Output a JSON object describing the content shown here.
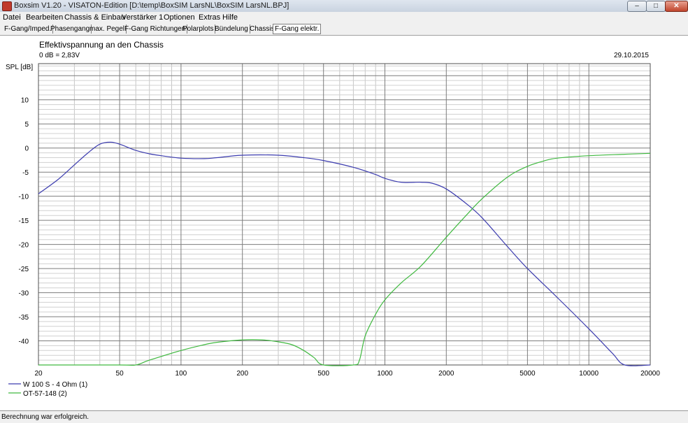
{
  "window": {
    "title": "Boxsim V1.20 - VISATON-Edition [D:\\temp\\BoxSIM LarsNL\\BoxSIM LarsNL.BPJ]",
    "min_glyph": "–",
    "max_glyph": "□",
    "close_glyph": "✕"
  },
  "menu": [
    "Datei",
    "Bearbeiten",
    "Chassis & Einbau",
    "Verstärker 1",
    "Optionen",
    "Extras",
    "Hilfe"
  ],
  "tabs": [
    "F-Gang/Imped.",
    "Phasengang",
    "max. Pegel",
    "F-Gang Richtungen",
    "Polarplots",
    "Bündelung",
    "Chassis",
    "F-Gang elektr."
  ],
  "active_tab": 7,
  "chart_data": {
    "type": "line",
    "title": "Effektivspannung an den Chassis",
    "subtitle": "0 dB = 2,83V",
    "date": "29.10.2015",
    "ylabel": "SPL [dB]",
    "xlabel": "",
    "xscale": "log",
    "xlim": [
      20,
      20000
    ],
    "ylim": [
      -45,
      17.5
    ],
    "x_ticks": [
      "20",
      "50",
      "100",
      "200",
      "500",
      "1000",
      "2000",
      "5000",
      "10000",
      "20000"
    ],
    "y_ticks": [
      "10",
      "5",
      "0",
      "-5",
      "-10",
      "-15",
      "-20",
      "-25",
      "-30",
      "-35",
      "-40"
    ],
    "grid": true,
    "legend_position": "bottom-left",
    "series": [
      {
        "name": "W 100 S - 4 Ohm (1)",
        "color": "#3c3caf",
        "points": [
          [
            20,
            -9.5
          ],
          [
            25,
            -6.5
          ],
          [
            30,
            -3.5
          ],
          [
            35,
            -1
          ],
          [
            40,
            0.8
          ],
          [
            45,
            1.2
          ],
          [
            50,
            0.8
          ],
          [
            60,
            -0.5
          ],
          [
            70,
            -1.2
          ],
          [
            80,
            -1.6
          ],
          [
            100,
            -2.1
          ],
          [
            130,
            -2.2
          ],
          [
            150,
            -2.0
          ],
          [
            200,
            -1.5
          ],
          [
            300,
            -1.5
          ],
          [
            400,
            -2.0
          ],
          [
            500,
            -2.6
          ],
          [
            700,
            -4.0
          ],
          [
            900,
            -5.5
          ],
          [
            1000,
            -6.3
          ],
          [
            1200,
            -7.1
          ],
          [
            1500,
            -7.1
          ],
          [
            1700,
            -7.3
          ],
          [
            2000,
            -8.5
          ],
          [
            2500,
            -11.5
          ],
          [
            3000,
            -14.5
          ],
          [
            4000,
            -20.5
          ],
          [
            5000,
            -25
          ],
          [
            7000,
            -31
          ],
          [
            10000,
            -37.5
          ],
          [
            13000,
            -42.5
          ],
          [
            15000,
            -45
          ],
          [
            20000,
            -45
          ]
        ]
      },
      {
        "name": "OT-57-148 (2)",
        "color": "#40b940",
        "points": [
          [
            20,
            -45
          ],
          [
            50,
            -45
          ],
          [
            60,
            -45
          ],
          [
            70,
            -44
          ],
          [
            100,
            -42
          ],
          [
            130,
            -40.8
          ],
          [
            150,
            -40.3
          ],
          [
            200,
            -39.8
          ],
          [
            250,
            -39.8
          ],
          [
            300,
            -40.2
          ],
          [
            350,
            -40.8
          ],
          [
            400,
            -42
          ],
          [
            450,
            -43.5
          ],
          [
            500,
            -45
          ],
          [
            700,
            -45
          ],
          [
            750,
            -44
          ],
          [
            800,
            -39
          ],
          [
            900,
            -34.5
          ],
          [
            1000,
            -31.5
          ],
          [
            1200,
            -28
          ],
          [
            1500,
            -24.5
          ],
          [
            2000,
            -18.5
          ],
          [
            2500,
            -14
          ],
          [
            3000,
            -10.5
          ],
          [
            4000,
            -6
          ],
          [
            5000,
            -3.8
          ],
          [
            6000,
            -2.7
          ],
          [
            7000,
            -2.1
          ],
          [
            10000,
            -1.6
          ],
          [
            15000,
            -1.3
          ],
          [
            20000,
            -1.1
          ]
        ]
      }
    ]
  },
  "status": "Berechnung war erfolgreich."
}
